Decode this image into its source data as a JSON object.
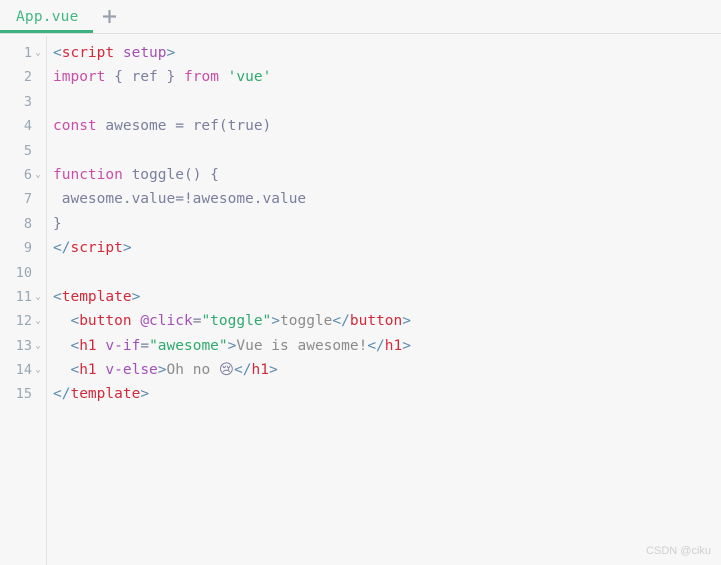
{
  "tabbar": {
    "tabs": [
      {
        "label": "App.vue",
        "active": true,
        "accent_color": "#3cb37e"
      }
    ],
    "new_tab_icon": "plus-icon",
    "new_tab_tooltip": "+"
  },
  "editor": {
    "background_color": "#f7f7f7",
    "line_number_color": "#9aa7b4",
    "fold_marker": "⌄",
    "lines": [
      {
        "number": "1",
        "foldable": true,
        "tokens": [
          {
            "text": "<",
            "type": "punct"
          },
          {
            "text": "script",
            "type": "tag"
          },
          {
            "text": " ",
            "type": "plain"
          },
          {
            "text": "setup",
            "type": "attr"
          },
          {
            "text": ">",
            "type": "punct"
          }
        ]
      },
      {
        "number": "2",
        "foldable": false,
        "tokens": [
          {
            "text": "import",
            "type": "keyword"
          },
          {
            "text": " { ",
            "type": "plain"
          },
          {
            "text": "ref",
            "type": "plain"
          },
          {
            "text": " } ",
            "type": "plain"
          },
          {
            "text": "from",
            "type": "keyword"
          },
          {
            "text": " ",
            "type": "plain"
          },
          {
            "text": "'vue'",
            "type": "string"
          }
        ]
      },
      {
        "number": "3",
        "foldable": false,
        "tokens": []
      },
      {
        "number": "4",
        "foldable": false,
        "tokens": [
          {
            "text": "const",
            "type": "keyword"
          },
          {
            "text": " awesome = ",
            "type": "plain"
          },
          {
            "text": "ref",
            "type": "plain"
          },
          {
            "text": "(",
            "type": "plain"
          },
          {
            "text": "true",
            "type": "plain"
          },
          {
            "text": ")",
            "type": "plain"
          }
        ]
      },
      {
        "number": "5",
        "foldable": false,
        "tokens": []
      },
      {
        "number": "6",
        "foldable": true,
        "tokens": [
          {
            "text": "function",
            "type": "keyword"
          },
          {
            "text": " ",
            "type": "plain"
          },
          {
            "text": "toggle",
            "type": "plain"
          },
          {
            "text": "() {",
            "type": "plain"
          }
        ]
      },
      {
        "number": "7",
        "foldable": false,
        "tokens": [
          {
            "text": " awesome.value=!awesome.value",
            "type": "plain"
          }
        ]
      },
      {
        "number": "8",
        "foldable": false,
        "tokens": [
          {
            "text": "}",
            "type": "plain"
          }
        ]
      },
      {
        "number": "9",
        "foldable": false,
        "tokens": [
          {
            "text": "</",
            "type": "punct"
          },
          {
            "text": "script",
            "type": "tag"
          },
          {
            "text": ">",
            "type": "punct"
          }
        ]
      },
      {
        "number": "10",
        "foldable": false,
        "tokens": []
      },
      {
        "number": "11",
        "foldable": true,
        "tokens": [
          {
            "text": "<",
            "type": "punct"
          },
          {
            "text": "template",
            "type": "tag"
          },
          {
            "text": ">",
            "type": "punct"
          }
        ]
      },
      {
        "number": "12",
        "foldable": true,
        "tokens": [
          {
            "text": "  <",
            "type": "punct"
          },
          {
            "text": "button",
            "type": "tag"
          },
          {
            "text": " ",
            "type": "plain"
          },
          {
            "text": "@click",
            "type": "attr"
          },
          {
            "text": "=",
            "type": "plain"
          },
          {
            "text": "\"toggle\"",
            "type": "string"
          },
          {
            "text": ">",
            "type": "punct"
          },
          {
            "text": "toggle",
            "type": "text"
          },
          {
            "text": "</",
            "type": "punct"
          },
          {
            "text": "button",
            "type": "tag"
          },
          {
            "text": ">",
            "type": "punct"
          }
        ]
      },
      {
        "number": "13",
        "foldable": true,
        "tokens": [
          {
            "text": "  <",
            "type": "punct"
          },
          {
            "text": "h1",
            "type": "tag"
          },
          {
            "text": " ",
            "type": "plain"
          },
          {
            "text": "v-if",
            "type": "attr"
          },
          {
            "text": "=",
            "type": "plain"
          },
          {
            "text": "\"awesome\"",
            "type": "string"
          },
          {
            "text": ">",
            "type": "punct"
          },
          {
            "text": "Vue is awesome!",
            "type": "text"
          },
          {
            "text": "</",
            "type": "punct"
          },
          {
            "text": "h1",
            "type": "tag"
          },
          {
            "text": ">",
            "type": "punct"
          }
        ]
      },
      {
        "number": "14",
        "foldable": true,
        "tokens": [
          {
            "text": "  <",
            "type": "punct"
          },
          {
            "text": "h1",
            "type": "tag"
          },
          {
            "text": " ",
            "type": "plain"
          },
          {
            "text": "v-else",
            "type": "attr"
          },
          {
            "text": ">",
            "type": "punct"
          },
          {
            "text": "Oh no ",
            "type": "text"
          },
          {
            "text": "😢",
            "type": "emoji"
          },
          {
            "text": "</",
            "type": "punct"
          },
          {
            "text": "h1",
            "type": "tag"
          },
          {
            "text": ">",
            "type": "punct"
          }
        ]
      },
      {
        "number": "15",
        "foldable": false,
        "tokens": [
          {
            "text": "</",
            "type": "punct"
          },
          {
            "text": "template",
            "type": "tag"
          },
          {
            "text": ">",
            "type": "punct"
          }
        ]
      }
    ]
  },
  "watermark": {
    "text": "CSDN @ciku"
  }
}
